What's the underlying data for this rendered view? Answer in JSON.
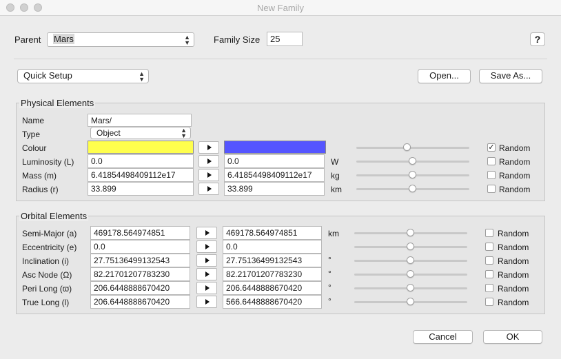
{
  "window": {
    "title": "New Family"
  },
  "top": {
    "parent_label": "Parent",
    "parent_value": "Mars",
    "family_size_label": "Family Size",
    "family_size_value": "25",
    "help_label": "?"
  },
  "setup": {
    "quick_setup": "Quick Setup",
    "open_label": "Open...",
    "save_as_label": "Save As..."
  },
  "physical": {
    "title": "Physical Elements",
    "name_label": "Name",
    "name_value": "Mars/",
    "type_label": "Type",
    "type_value": "Object",
    "colour_label": "Colour",
    "colour_from": "#ffff4d",
    "colour_to": "#5555ff",
    "random_label": "Random",
    "rows": [
      {
        "label": "Colour",
        "unit": "",
        "slider": 0.45,
        "random": true
      },
      {
        "label": "Luminosity (L)",
        "from": "0.0",
        "to": "0.0",
        "unit": "W",
        "slider": 0.5,
        "random": false
      },
      {
        "label": "Mass (m)",
        "from": "6.41854498409112e17",
        "to": "6.41854498409112e17",
        "unit": "kg",
        "slider": 0.5,
        "random": false
      },
      {
        "label": "Radius (r)",
        "from": "33.899",
        "to": "33.899",
        "unit": "km",
        "slider": 0.5,
        "random": false
      }
    ]
  },
  "orbital": {
    "title": "Orbital Elements",
    "random_label": "Random",
    "rows": [
      {
        "label": "Semi-Major (a)",
        "from": "469178.564974851",
        "to": "469178.564974851",
        "unit": "km",
        "slider": 0.5,
        "random": false
      },
      {
        "label": "Eccentricity (e)",
        "from": "0.0",
        "to": "0.0",
        "unit": "",
        "slider": 0.5,
        "random": false
      },
      {
        "label": "Inclination (i)",
        "from": "27.75136499132543",
        "to": "27.75136499132543",
        "unit": "°",
        "slider": 0.5,
        "random": false
      },
      {
        "label": "Asc Node (Ω)",
        "from": "82.21701207783230",
        "to": "82.21701207783230",
        "unit": "°",
        "slider": 0.5,
        "random": false
      },
      {
        "label": "Peri Long (ϖ)",
        "from": "206.6448888670420",
        "to": "206.6448888670420",
        "unit": "°",
        "slider": 0.5,
        "random": false
      },
      {
        "label": "True Long (l)",
        "from": "206.6448888670420",
        "to": "566.6448888670420",
        "unit": "°",
        "slider": 0.5,
        "random": false
      }
    ]
  },
  "footer": {
    "cancel_label": "Cancel",
    "ok_label": "OK"
  }
}
